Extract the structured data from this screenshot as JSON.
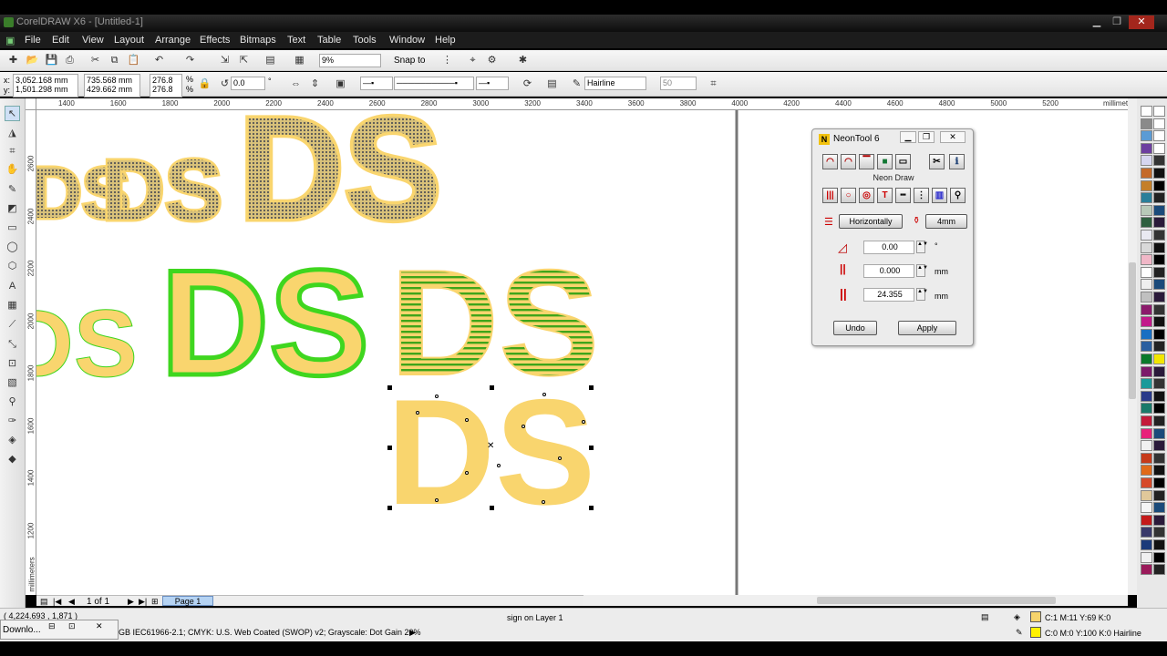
{
  "window": {
    "title": "CorelDRAW X6 - [Untitled-1]"
  },
  "menu": [
    "File",
    "Edit",
    "View",
    "Layout",
    "Arrange",
    "Effects",
    "Bitmaps",
    "Text",
    "Table",
    "Tools",
    "Window",
    "Help"
  ],
  "std_toolbar": {
    "zoom": "9%",
    "snap": "Snap to"
  },
  "prop_bar": {
    "x": "3,052.168 mm",
    "y": "1,501.298 mm",
    "w": "735.568 mm",
    "h": "429.662 mm",
    "sx": "276.8",
    "sy": "276.8",
    "pct": "%",
    "angle": "0.0",
    "deg": "°",
    "outline": "Hairline",
    "nudge": "50"
  },
  "ruler": {
    "units": "millimeters",
    "h_ticks": [
      "1400",
      "1600",
      "1800",
      "2000",
      "2200",
      "2400",
      "2600",
      "2800",
      "3000",
      "3200",
      "3400",
      "3600",
      "3800",
      "4000",
      "4200",
      "4400",
      "4600",
      "4800",
      "5000",
      "5200"
    ],
    "v_ticks": [
      "2600",
      "2400",
      "2200",
      "2000",
      "1800",
      "1600",
      "1400",
      "1200"
    ],
    "v_units": "millimeters"
  },
  "canvas": {
    "text": "DS",
    "letter_fill": "#f9d56e",
    "neon_green": "#3fd61f"
  },
  "neontool": {
    "title": "NeonTool 6",
    "section": "Neon Draw",
    "direction": "Horizontally",
    "size": "4mm",
    "angle": "0.00",
    "angle_unit": "°",
    "spacing": "0.000",
    "spacing_unit": "mm",
    "width": "24.355",
    "width_unit": "mm",
    "undo": "Undo",
    "apply": "Apply"
  },
  "pagebar": {
    "page_count": "1 of 1",
    "page_tab": "Page 1"
  },
  "status": {
    "coords": "( 4,224.693 , 1,871 )",
    "layer": "sign on Layer 1",
    "profile": "GB IEC61966-2.1; CMYK: U.S. Web Coated (SWOP) v2; Grayscale: Dot Gain 20%",
    "fill": "C:1 M:11 Y:69 K:0",
    "outline": "C:0 M:0 Y:100 K:0  Hairline",
    "taskbar_item": "Downlo..."
  },
  "colors": {
    "fill_swatch": "#f6d46c",
    "outline_swatch": "#fff200"
  }
}
